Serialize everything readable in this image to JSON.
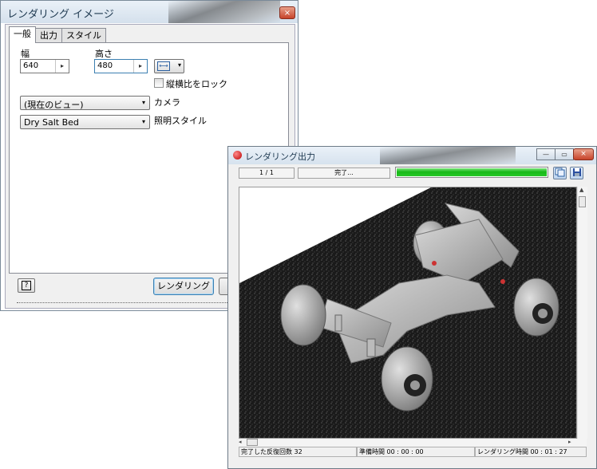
{
  "render_image": {
    "title": "レンダリング イメージ",
    "close_label": "×",
    "tabs": [
      {
        "label": "一般"
      },
      {
        "label": "出力"
      },
      {
        "label": "スタイル"
      }
    ],
    "width_label": "幅",
    "width_value": "640",
    "height_label": "高さ",
    "height_value": "480",
    "spin_arrow": "▸",
    "size_icon": "⟷",
    "caret": "▾",
    "lock_aspect_label": "縦横比をロック",
    "camera_value": "(現在のビュー)",
    "camera_label": "カメラ",
    "lighting_value": "Dry Salt Bed",
    "lighting_label": "照明スタイル",
    "help_label": "?",
    "render_button": "レンダリング"
  },
  "render_output": {
    "title": "レンダリング出力",
    "minimize": "—",
    "maximize": "▭",
    "close_label": "×",
    "pass_counter": "1 / 1",
    "status": "完了...",
    "progress": 1.0,
    "progress_color": "#1fbf1f",
    "status_bar": {
      "iterations": "完了した反復回数  32",
      "prep_time": "準備時間  00 : 00 : 00",
      "render_time": "レンダリング時間  00 : 01 : 27"
    }
  }
}
